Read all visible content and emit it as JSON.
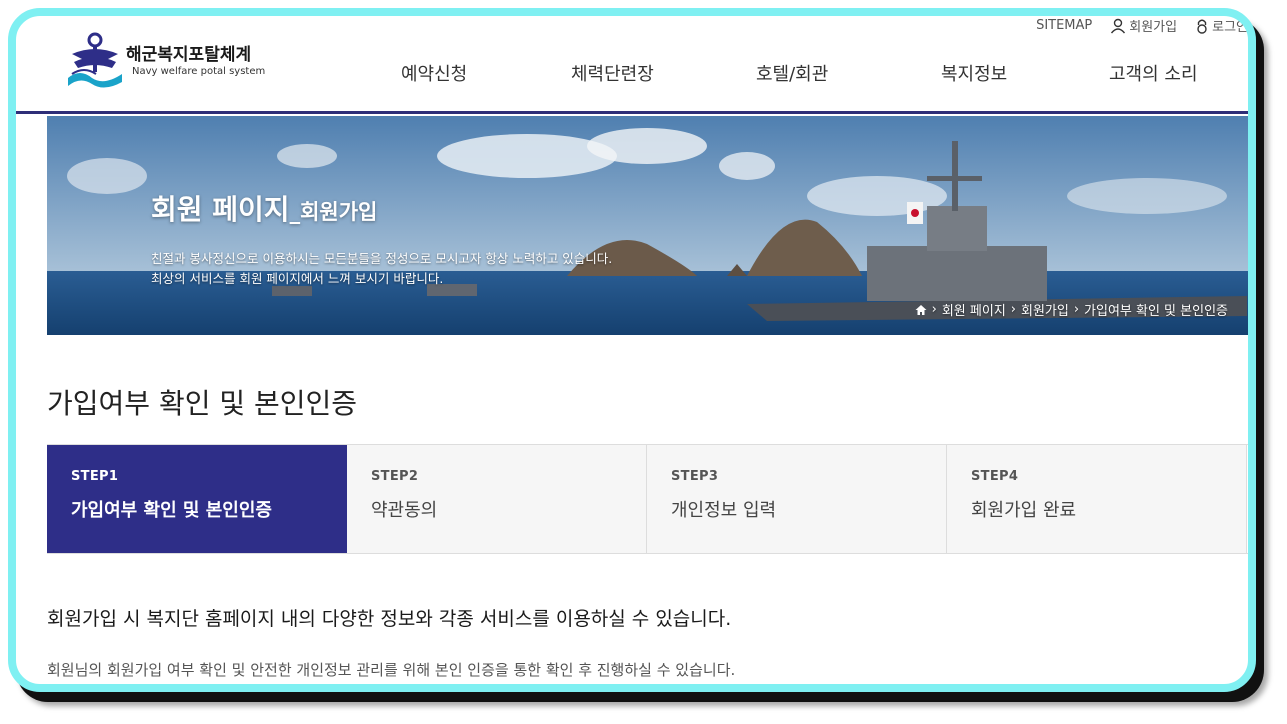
{
  "brand": {
    "title": "해군복지포탈체계",
    "subtitle": "Navy welfare potal system"
  },
  "util_nav": {
    "sitemap": "SITEMAP",
    "join": "회원가입",
    "login": "로그인"
  },
  "gnb": [
    "예약신청",
    "체력단련장",
    "호텔/회관",
    "복지정보",
    "고객의 소리"
  ],
  "banner": {
    "title_main": "회원 페이지",
    "title_sub": "_회원가입",
    "desc_line1": "친절과 봉사정신으로 이용하시는 모든분들을 정성으로 모시고자 항상 노력하고 있습니다.",
    "desc_line2": "최상의 서비스를 회원 페이지에서 느껴 보시기 바랍니다.",
    "breadcrumb": [
      "회원 페이지",
      "회원가입",
      "가입여부 확인 및 본인인증"
    ]
  },
  "page_title": "가입여부 확인 및 본인인증",
  "steps": [
    {
      "num": "STEP1",
      "label": "가입여부 확인 및 본인인증",
      "active": true
    },
    {
      "num": "STEP2",
      "label": "약관동의",
      "active": false
    },
    {
      "num": "STEP3",
      "label": "개인정보 입력",
      "active": false
    },
    {
      "num": "STEP4",
      "label": "회원가입 완료",
      "active": false
    }
  ],
  "lead_text": "회원가입 시 복지단 홈페이지 내의 다양한 정보와 각종 서비스를 이용하실 수 있습니다.",
  "note_text": "회원님의 회원가입 여부 확인 및 안전한 개인정보 관리를 위해 본인 인증을 통한 확인 후 진행하실 수 있습니다.",
  "colors": {
    "accent": "#2e2e88",
    "frame": "#7ff0f2",
    "nav_rule": "#2e2e78"
  }
}
